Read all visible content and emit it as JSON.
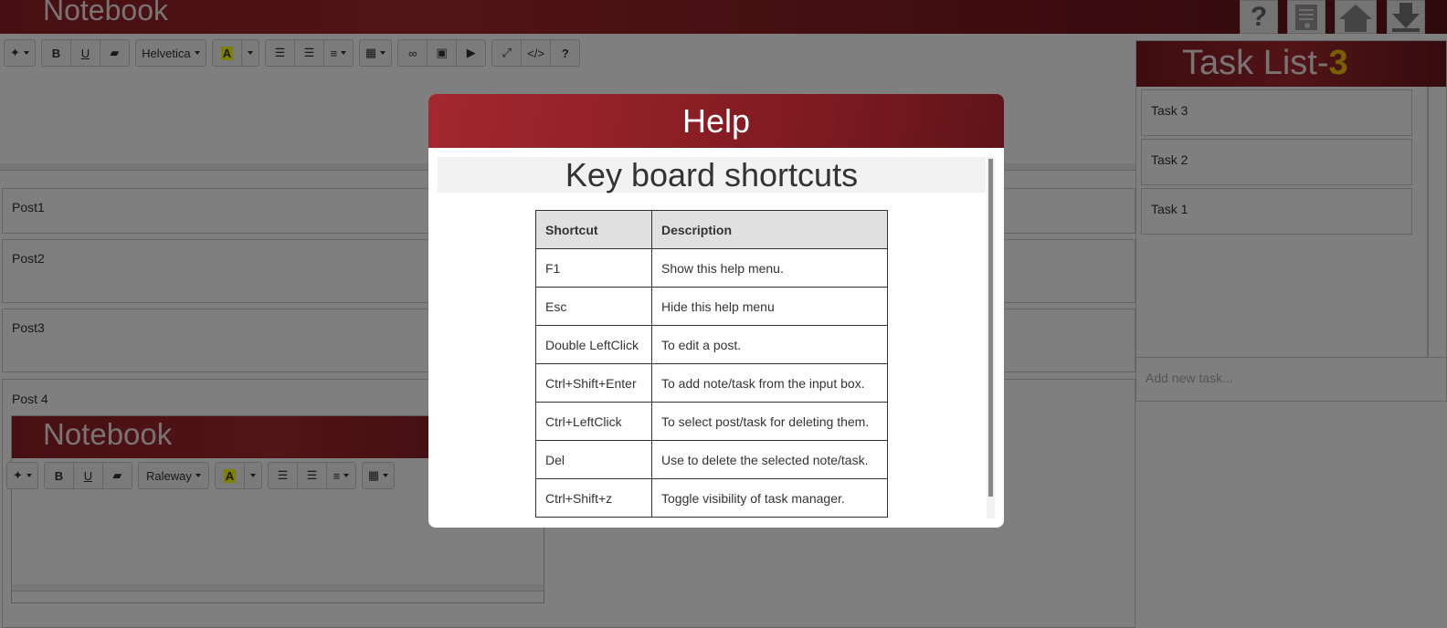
{
  "app": {
    "title": "Notebook",
    "toolbar": {
      "font_name": "Helvetica",
      "font_color_glyph": "A",
      "bold": "B",
      "underline": "U",
      "help": "?"
    }
  },
  "header_buttons": [
    {
      "icon": "help-icon",
      "label": "?"
    },
    {
      "icon": "notes-icon"
    },
    {
      "icon": "home-icon"
    },
    {
      "icon": "download-icon"
    }
  ],
  "posts": [
    {
      "label": "Post1"
    },
    {
      "label": "Post2"
    },
    {
      "label": "Post3"
    },
    {
      "label": "Post 4"
    }
  ],
  "nested_notebook": {
    "title": "Notebook",
    "font_name": "Raleway",
    "font_color_glyph": "A",
    "bold": "B",
    "underline": "U"
  },
  "task_list": {
    "title": "Task List-",
    "count": "3",
    "tasks": [
      "Task 3",
      "Task 2",
      "Task 1"
    ],
    "new_task_placeholder": "Add new task..."
  },
  "help_modal": {
    "title": "Help",
    "section_title": "Key board shortcuts",
    "columns": [
      "Shortcut",
      "Description"
    ],
    "rows": [
      {
        "shortcut": "F1",
        "description": "Show this help menu."
      },
      {
        "shortcut": "Esc",
        "description": "Hide this help menu"
      },
      {
        "shortcut": "Double LeftClick",
        "description": "To edit a post."
      },
      {
        "shortcut": "Ctrl+Shift+Enter",
        "description": "To add note/task from the input box."
      },
      {
        "shortcut": "Ctrl+LeftClick",
        "description": "To select post/task for deleting them."
      },
      {
        "shortcut": "Del",
        "description": "Use to delete the selected note/task."
      },
      {
        "shortcut": "Ctrl+Shift+z",
        "description": "Toggle visibility of task manager."
      }
    ]
  },
  "colors": {
    "brand_red": "#8e1f26",
    "count_yellow": "#f2c200",
    "overlay": "rgba(0,0,0,0.5)"
  }
}
